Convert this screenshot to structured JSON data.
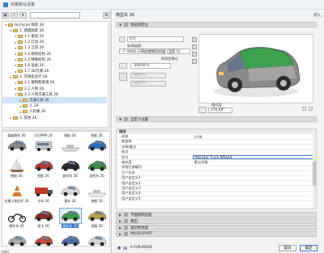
{
  "window": {
    "title": "对象默认设置"
  },
  "left": {
    "tree": [
      {
        "label": "Archicad 图库 26",
        "expanded": true,
        "depth": 0
      },
      {
        "label": "1. 基础图库 26",
        "expanded": true,
        "depth": 1
      },
      {
        "label": "1.1 家具 26",
        "expanded": false,
        "depth": 2
      },
      {
        "label": "1.2 灯具 26",
        "expanded": false,
        "depth": 2
      },
      {
        "label": "1.3 卫浴 26",
        "expanded": false,
        "depth": 2
      },
      {
        "label": "1.4 建筑结构 26",
        "expanded": false,
        "depth": 2
      },
      {
        "label": "1.5 特殊结构 26",
        "expanded": false,
        "depth": 2
      },
      {
        "label": "1.6 设备 26",
        "expanded": false,
        "depth": 2
      },
      {
        "label": "1.7 2D元素 26",
        "expanded": false,
        "depth": 2
      },
      {
        "label": "2. 可视化设计 26",
        "expanded": true,
        "depth": 1
      },
      {
        "label": "2.1 植物和景观 26",
        "expanded": false,
        "depth": 2
      },
      {
        "label": "2.2 人物 26",
        "expanded": false,
        "depth": 2
      },
      {
        "label": "2.3 人和交通工具 26",
        "expanded": true,
        "depth": 2
      },
      {
        "label": "交通工具 26",
        "expanded": false,
        "depth": 3,
        "selected": true
      },
      {
        "label": "人 26",
        "expanded": false,
        "depth": 3
      },
      {
        "label": "人轮廓 26",
        "expanded": false,
        "depth": 3
      },
      {
        "label": "3. 其他 26",
        "expanded": false,
        "depth": 1
      }
    ],
    "thumbs": [
      {
        "label": "超级跑车 26",
        "kind": "car",
        "color": "#8a8a8a"
      },
      {
        "label": "大巴MPV 26",
        "kind": "van",
        "color": "#c7c7c7"
      },
      {
        "label": "帆船 26",
        "kind": "boat",
        "color": "#dcdcdc"
      },
      {
        "label": "帆船 26",
        "kind": "car",
        "color": "#2f6fb8"
      },
      {
        "label": "帆船 26",
        "kind": "sail",
        "color": "#e6e6e6"
      },
      {
        "label": "帆船 26",
        "kind": "car",
        "color": "#b23a32"
      },
      {
        "label": "豪华车 26",
        "kind": "car",
        "color": "#2b2b2b"
      },
      {
        "label": "混合车 26",
        "kind": "car",
        "color": "#3d8a44"
      },
      {
        "label": "交通工具拉杆 26",
        "kind": "cone",
        "color": "#d77a2a"
      },
      {
        "label": "卡车 26",
        "kind": "truck",
        "color": "#c0392b"
      },
      {
        "label": "客车 26",
        "kind": "car",
        "color": "#d9d9d9"
      },
      {
        "label": "快艇 26",
        "kind": "boat",
        "color": "#f0f0f0"
      },
      {
        "label": "摩托车 26",
        "kind": "moto",
        "color": "#333333"
      },
      {
        "label": "皮卡 26",
        "kind": "car",
        "color": "#8b2b2b"
      },
      {
        "label": "微型车 26",
        "kind": "car",
        "color": "#3a9b4a",
        "selected": true
      },
      {
        "label": "游艇 26",
        "kind": "car",
        "color": "#b6a14a"
      },
      {
        "label": "",
        "kind": "car",
        "color": "#a8a8a8"
      },
      {
        "label": "",
        "kind": "car",
        "color": "#c04a3a"
      },
      {
        "label": "",
        "kind": "car",
        "color": "#4a6fa8"
      },
      {
        "label": "",
        "kind": "car",
        "color": "#d4d4d4"
      }
    ]
  },
  "right": {
    "object_name": "微型车 26",
    "default_label": "默认",
    "sections": {
      "preview": "预览和定位",
      "custom": "自定义设置",
      "classification": "平面图和剖面",
      "model": "模型",
      "category": "类别和性能",
      "modelport": "MODELPORT"
    },
    "fields": {
      "elevation": "0.0",
      "layer_label": "标高链接:",
      "layer_value": "-7. MOD-三四层楼梯剖切面 (当前 5)",
      "home_story_label": "到项目零点",
      "offset": "-30450.0",
      "width": "2685.0",
      "depth": "1666.0",
      "angle": "270.00°",
      "angle_label": "相对层"
    },
    "table_header": "描述",
    "rows": [
      {
        "key": "描述",
        "value": "",
        "header": true
      },
      {
        "key": "成本",
        "value": "0.00"
      },
      {
        "key": "制造商",
        "value": ""
      },
      {
        "key": "注释/备注",
        "value": ""
      },
      {
        "key": "地点",
        "value": ""
      },
      {
        "key": "型号",
        "value": "Monster Truck Wheels",
        "active": true
      },
      {
        "key": "电灰度",
        "value": "默认列表"
      },
      {
        "key": "详细注册编号",
        "value": ""
      },
      {
        "key": "生产年份",
        "value": ""
      },
      {
        "key": "用户自定义1",
        "value": ""
      },
      {
        "key": "用户自定义2",
        "value": ""
      },
      {
        "key": "用户自定义3",
        "value": ""
      },
      {
        "key": "用户自定义4",
        "value": ""
      },
      {
        "key": "用户自定义5",
        "value": ""
      }
    ],
    "layer_footer": "A-FUR-MOVE",
    "cancel_label": "取消",
    "ok_label": "确定"
  }
}
